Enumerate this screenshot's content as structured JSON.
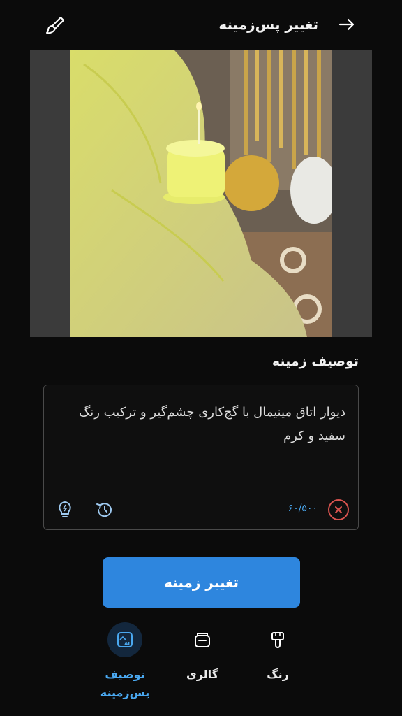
{
  "header": {
    "title": "تغییر پس‌زمینه",
    "back_icon": "arrow-right-icon",
    "brush_icon": "brush-icon"
  },
  "preview": {
    "image_desc_icon": "photo-preview"
  },
  "description": {
    "label": "توصیف زمینه",
    "text": "دیوار اتاق مینیمال با گچ‌کاری چشم‌گیر و ترکیب رنگ سفید و کرم",
    "counter": "۶۰/۵۰۰",
    "clear_icon": "close-icon",
    "history_icon": "history-icon",
    "idea_icon": "lightbulb-icon"
  },
  "primary_button": {
    "label": "تغییر زمینه"
  },
  "tabs": [
    {
      "label": "توصیف پس‌زمینه",
      "icon": "ai-image-icon",
      "active": true
    },
    {
      "label": "گالری",
      "icon": "gallery-icon",
      "active": false
    },
    {
      "label": "رنگ",
      "icon": "paint-brush-icon",
      "active": false
    }
  ],
  "colors": {
    "accent": "#2e86de",
    "active_tab_text": "#4aa8f0",
    "danger": "#d9534f",
    "background": "#0b0b0b"
  }
}
